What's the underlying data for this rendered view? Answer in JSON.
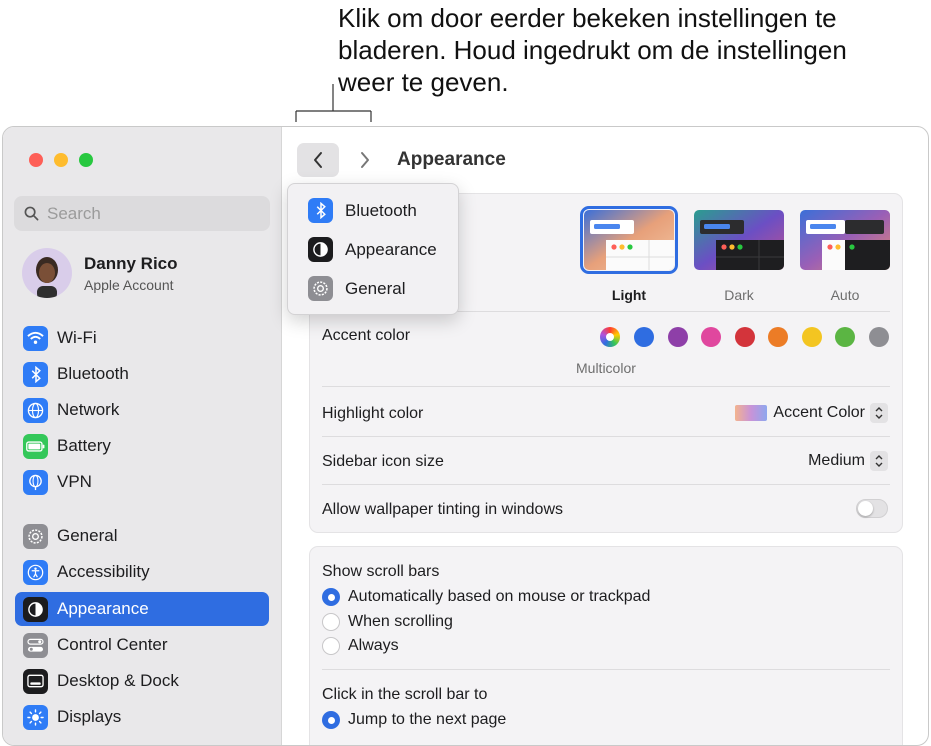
{
  "callout": {
    "line1": "Klik om door eerder bekeken instellingen te",
    "line2": "bladeren. Houd ingedrukt om de instellingen",
    "line3": "weer te geven."
  },
  "search": {
    "placeholder": "Search"
  },
  "account": {
    "name": "Danny Rico",
    "subtitle": "Apple Account"
  },
  "sidebar": {
    "items": [
      {
        "label": "Wi-Fi",
        "icon": "wifi-icon"
      },
      {
        "label": "Bluetooth",
        "icon": "bluetooth-icon"
      },
      {
        "label": "Network",
        "icon": "globe-icon"
      },
      {
        "label": "Battery",
        "icon": "battery-icon"
      },
      {
        "label": "VPN",
        "icon": "vpn-icon"
      },
      {
        "label": "General",
        "icon": "gear-icon"
      },
      {
        "label": "Accessibility",
        "icon": "accessibility-icon"
      },
      {
        "label": "Appearance",
        "icon": "appearance-icon",
        "selected": true
      },
      {
        "label": "Control Center",
        "icon": "control-center-icon"
      },
      {
        "label": "Desktop & Dock",
        "icon": "desktop-dock-icon"
      },
      {
        "label": "Displays",
        "icon": "sun-icon"
      }
    ]
  },
  "toolbar": {
    "title": "Appearance"
  },
  "history_menu": {
    "items": [
      {
        "label": "Bluetooth",
        "icon": "bluetooth-icon"
      },
      {
        "label": "Appearance",
        "icon": "appearance-icon"
      },
      {
        "label": "General",
        "icon": "gear-icon"
      }
    ]
  },
  "appearance": {
    "options": [
      {
        "label": "Light",
        "selected": true
      },
      {
        "label": "Dark",
        "selected": false
      },
      {
        "label": "Auto",
        "selected": false
      }
    ]
  },
  "accent": {
    "label": "Accent color",
    "selected_name": "Multicolor",
    "colors": [
      "multicolor",
      "#2f6de1",
      "#8e3fa8",
      "#e0479e",
      "#d3343b",
      "#ec7c26",
      "#f3c521",
      "#5bb543",
      "#8e8e93"
    ]
  },
  "highlight": {
    "label": "Highlight color",
    "value": "Accent Color"
  },
  "sidebar_icon_size": {
    "label": "Sidebar icon size",
    "value": "Medium"
  },
  "wallpaper_tinting": {
    "label": "Allow wallpaper tinting in windows",
    "enabled": false
  },
  "scroll_bars": {
    "label": "Show scroll bars",
    "options": [
      {
        "label": "Automatically based on mouse or trackpad",
        "selected": true
      },
      {
        "label": "When scrolling",
        "selected": false
      },
      {
        "label": "Always",
        "selected": false
      }
    ]
  },
  "click_scroll": {
    "label": "Click in the scroll bar to",
    "options": [
      {
        "label": "Jump to the next page",
        "selected": true
      }
    ]
  },
  "colors": {
    "accent": "#2f6de1",
    "sidebar_bg": "#e9e8ea"
  }
}
